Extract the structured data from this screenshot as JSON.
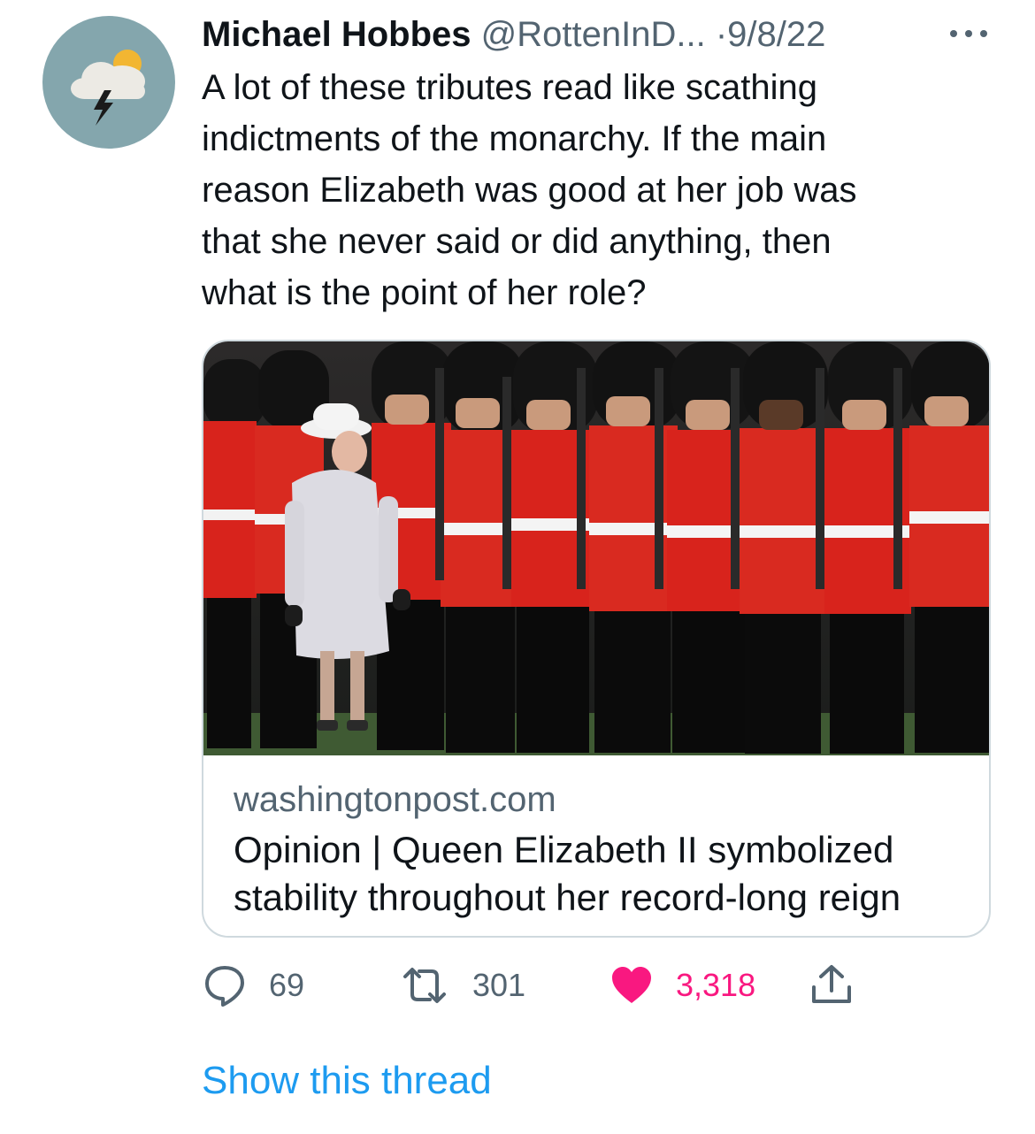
{
  "tweet": {
    "author_name": "Michael Hobbes",
    "handle": "@RottenInD...",
    "separator": "·",
    "date": "9/8/22",
    "text": "A lot of these tributes read like scathing\nindictments of the monarchy. If the main\nreason Elizabeth was good at her job was\nthat she never said or did anything, then\nwhat is the point of her role?"
  },
  "avatar": {
    "icon": "thunderstorm-cloud-icon",
    "background": "#84a6ad"
  },
  "card": {
    "image": "queen-elizabeth-inspecting-guards-photo",
    "domain": "washingtonpost.com",
    "title": "Opinion | Queen Elizabeth II symbolized stability throughout her record-long reign"
  },
  "actions": {
    "replies": {
      "icon": "reply-icon",
      "count": "69"
    },
    "retweets": {
      "icon": "retweet-icon",
      "count": "301"
    },
    "likes": {
      "icon": "heart-icon",
      "count": "3,318",
      "color": "#f91880"
    },
    "share": {
      "icon": "share-icon"
    }
  },
  "show_thread": "Show this thread",
  "colors": {
    "link": "#1d9bf0",
    "muted": "#536471",
    "border": "#cfd9de"
  }
}
